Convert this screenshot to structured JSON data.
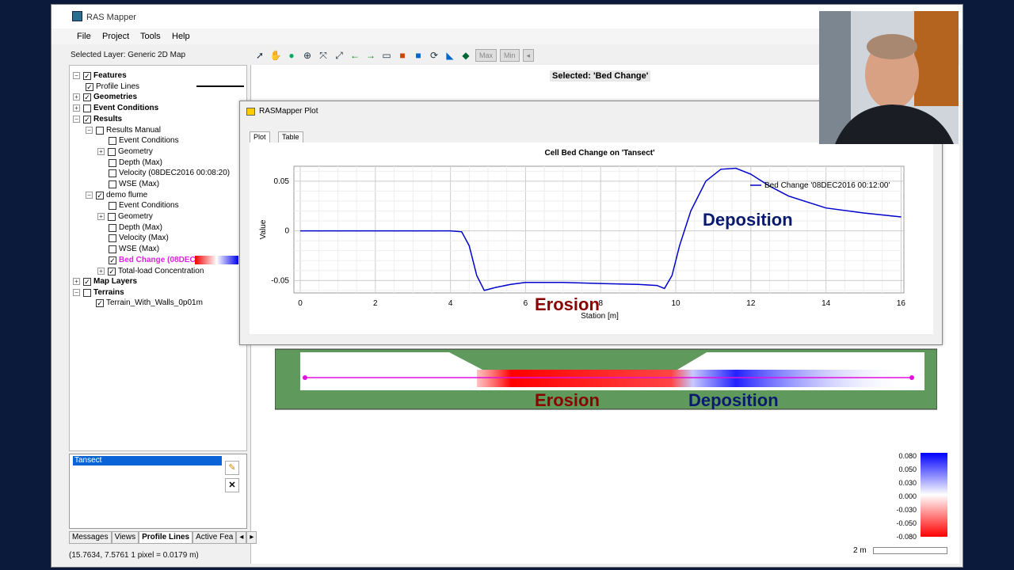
{
  "window": {
    "title": "RAS Mapper"
  },
  "menu": [
    "File",
    "Project",
    "Tools",
    "Help"
  ],
  "selected_layer": "Selected Layer: Generic 2D Map",
  "toolbar": {
    "max_label": "Max",
    "min_label": "Min"
  },
  "tree": {
    "features": "Features",
    "profile_lines": "Profile Lines",
    "geometries": "Geometries",
    "event_conditions": "Event Conditions",
    "results": "Results",
    "results_manual": "Results Manual",
    "rm_event_conditions": "Event Conditions",
    "rm_geometry": "Geometry",
    "rm_depth": "Depth (Max)",
    "rm_velocity": "Velocity (08DEC2016 00:08:20)",
    "rm_wse": "WSE (Max)",
    "demo_flume": "demo flume",
    "df_event_conditions": "Event Conditions",
    "df_geometry": "Geometry",
    "df_depth": "Depth (Max)",
    "df_velocity": "Velocity (Max)",
    "df_wse": "WSE (Max)",
    "df_bed_change": "Bed Change (08DEC",
    "df_total_load": "Total-load Concentration",
    "map_layers": "Map Layers",
    "terrains": "Terrains",
    "terrain_item": "Terrain_With_Walls_0p01m"
  },
  "map": {
    "selected": "Selected: 'Bed Change'",
    "erosion": "Erosion",
    "deposition": "Deposition"
  },
  "plot_window": {
    "title": "RASMapper Plot",
    "tab_plot": "Plot",
    "tab_table": "Table"
  },
  "chart_data": {
    "type": "line",
    "title": "Cell Bed Change on 'Tansect'",
    "xlabel": "Station [m]",
    "ylabel": "Value",
    "xlim": [
      0,
      16
    ],
    "ylim": [
      -0.0625,
      0.065
    ],
    "xticks": [
      "0",
      "2",
      "4",
      "6",
      "8",
      "10",
      "12",
      "14",
      "16"
    ],
    "yticks": [
      "0.05",
      "0",
      "-0.05"
    ],
    "series": [
      {
        "name": "Bed Change '08DEC2016 00:12:00'",
        "color": "#0000cc",
        "x": [
          0,
          2,
          4,
          4.3,
          4.5,
          4.7,
          4.9,
          5.2,
          5.6,
          6.0,
          7,
          8,
          9,
          9.5,
          9.7,
          9.9,
          10.1,
          10.4,
          10.8,
          11.2,
          11.6,
          12,
          12.5,
          13,
          14,
          15,
          16
        ],
        "y": [
          0,
          0,
          0,
          -0.001,
          -0.015,
          -0.045,
          -0.06,
          -0.057,
          -0.054,
          -0.052,
          -0.052,
          -0.053,
          -0.054,
          -0.055,
          -0.058,
          -0.045,
          -0.015,
          0.02,
          0.05,
          0.062,
          0.063,
          0.057,
          0.045,
          0.035,
          0.023,
          0.018,
          0.014
        ]
      }
    ],
    "annotations": [
      "Erosion",
      "Deposition"
    ],
    "grid": true,
    "legend": "top-right"
  },
  "transect_list": [
    "Tansect"
  ],
  "bottom_tabs": [
    "Messages",
    "Views",
    "Profile Lines",
    "Active Fea"
  ],
  "status": "(15.7634, 7.5761   1 pixel = 0.0179 m)",
  "legend": [
    "0.080",
    "0.050",
    "0.030",
    "0.000",
    "-0.030",
    "-0.050",
    "-0.080"
  ],
  "scale": "2 m"
}
